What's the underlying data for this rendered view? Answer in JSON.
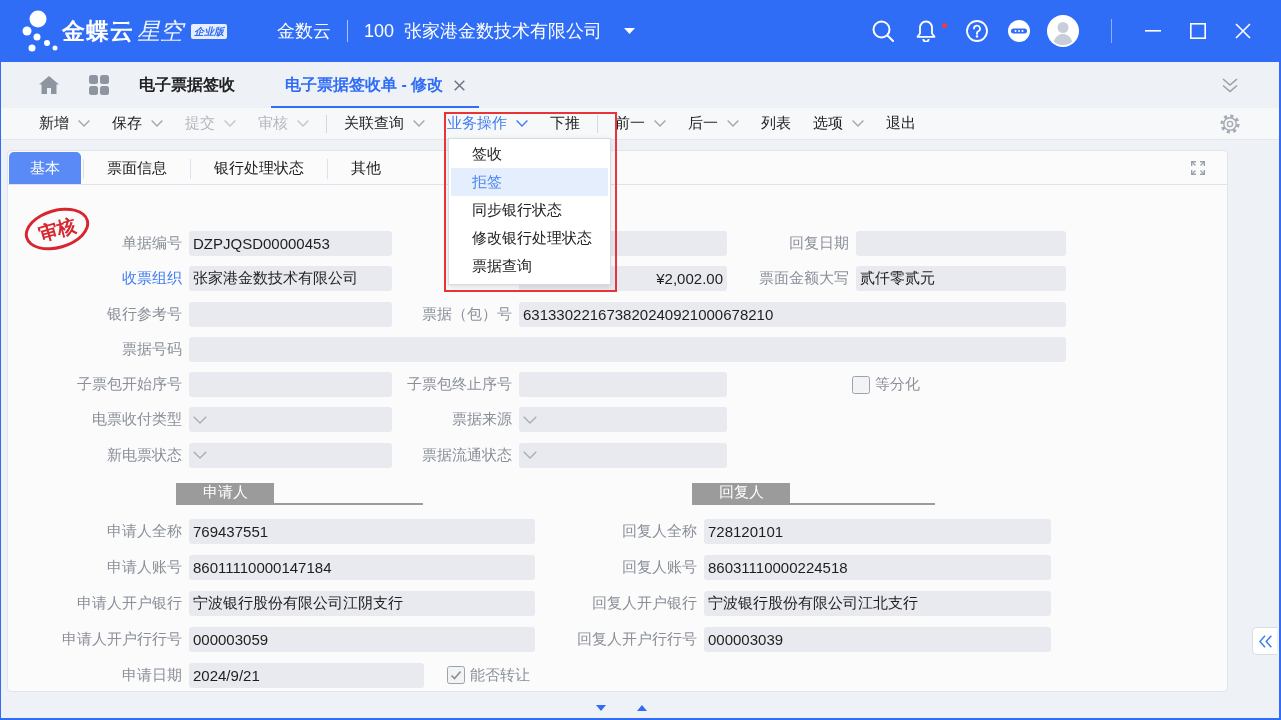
{
  "header": {
    "brand": "金蝶云",
    "product": "星空",
    "edition": "企业版",
    "tenant": "金数云",
    "org_code": "100",
    "org_name": "张家港金数技术有限公司",
    "unread": true
  },
  "page_tabs": [
    {
      "label": "电子票据签收",
      "selected": false,
      "closable": false
    },
    {
      "label": "电子票据签收单 - 修改",
      "selected": true,
      "closable": true
    }
  ],
  "toolbar": {
    "items": [
      {
        "label": "新增",
        "dropdown": true,
        "disabled": false,
        "selected": false,
        "divider_before": false
      },
      {
        "label": "保存",
        "dropdown": true,
        "disabled": false,
        "selected": false,
        "divider_before": false
      },
      {
        "label": "提交",
        "dropdown": true,
        "disabled": true,
        "selected": false,
        "divider_before": false
      },
      {
        "label": "审核",
        "dropdown": true,
        "disabled": true,
        "selected": false,
        "divider_before": false
      },
      {
        "label": "关联查询",
        "dropdown": true,
        "disabled": false,
        "selected": false,
        "divider_before": true
      },
      {
        "label": "业务操作",
        "dropdown": true,
        "disabled": false,
        "selected": true,
        "divider_before": false
      },
      {
        "label": "下推",
        "dropdown": false,
        "disabled": false,
        "selected": false,
        "divider_before": false
      },
      {
        "label": "前一",
        "dropdown": true,
        "disabled": false,
        "selected": false,
        "divider_before": true
      },
      {
        "label": "后一",
        "dropdown": true,
        "disabled": false,
        "selected": false,
        "divider_before": false
      },
      {
        "label": "列表",
        "dropdown": false,
        "disabled": false,
        "selected": false,
        "divider_before": false
      },
      {
        "label": "选项",
        "dropdown": true,
        "disabled": false,
        "selected": false,
        "divider_before": false
      },
      {
        "label": "退出",
        "dropdown": false,
        "disabled": false,
        "selected": false,
        "divider_before": false
      }
    ],
    "menu": [
      {
        "label": "签收",
        "selected": false
      },
      {
        "label": "拒签",
        "selected": true
      },
      {
        "label": "同步银行状态",
        "selected": false
      },
      {
        "label": "修改银行处理状态",
        "selected": false
      },
      {
        "label": "票据查询",
        "selected": false
      }
    ]
  },
  "form_tabs": [
    {
      "label": "基本",
      "selected": true
    },
    {
      "label": "票面信息",
      "selected": false
    },
    {
      "label": "银行处理状态",
      "selected": false
    },
    {
      "label": "其他",
      "selected": false
    }
  ],
  "stamp": "审核",
  "fields": [
    [
      {
        "kind": "text",
        "label": "单据编号",
        "value": "DZPJQSD00000453",
        "link": false,
        "wide": false
      },
      {
        "kind": "select"
      },
      {
        "kind": "text",
        "label": "回复日期",
        "link": false,
        "wide": false
      }
    ],
    [
      {
        "kind": "text",
        "label": "收票组织",
        "value": "张家港金数技术有限公司",
        "link": true,
        "wide": false
      },
      {
        "kind": "amount",
        "value": "¥2,002.00"
      },
      {
        "kind": "text",
        "label": "票面金额大写",
        "value": "贰仟零贰元",
        "link": false,
        "wide": false
      }
    ],
    [
      {
        "kind": "text",
        "label": "银行参考号",
        "link": false,
        "wide": false
      },
      {
        "kind": "text",
        "label": "票据（包）号",
        "value": "631330221673820240921000678210",
        "link": false,
        "wide": true
      }
    ],
    [
      {
        "kind": "text",
        "label": "票据号码",
        "link": false,
        "wide": true
      }
    ],
    [
      {
        "kind": "text",
        "label": "子票包开始序号",
        "link": false,
        "wide": false
      },
      {
        "kind": "text",
        "label": "子票包终止序号",
        "link": false,
        "wide": false
      },
      {
        "kind": "checkbox",
        "label": "等分化",
        "checked": false
      }
    ],
    [
      {
        "kind": "select",
        "label": "电票收付类型",
        "link": false,
        "wide": false
      },
      {
        "kind": "select",
        "label": "票据来源",
        "link": false,
        "wide": false
      }
    ],
    [
      {
        "kind": "select",
        "label": "新电票状态",
        "link": false,
        "wide": false
      },
      {
        "kind": "select",
        "label": "票据流通状态",
        "link": false,
        "wide": false
      }
    ]
  ],
  "parties": [
    {
      "title": "申请人",
      "fields": [
        {
          "label": "申请人全称",
          "value": "769437551"
        },
        {
          "label": "申请人账号",
          "value": "86011110000147184"
        },
        {
          "label": "申请人开户银行",
          "value": "宁波银行股份有限公司江阴支行"
        },
        {
          "label": "申请人开户行行号",
          "value": "000003059"
        }
      ]
    },
    {
      "title": "回复人",
      "fields": [
        {
          "label": "回复人全称",
          "value": "728120101"
        },
        {
          "label": "回复人账号",
          "value": "86031110000224518"
        },
        {
          "label": "回复人开户银行",
          "value": "宁波银行股份有限公司江北支行"
        },
        {
          "label": "回复人开户行行号",
          "value": "000003039"
        }
      ]
    }
  ],
  "bottom_row": [
    {
      "kind": "date",
      "label": "申请日期",
      "value": "2024/9/21"
    },
    {
      "kind": "checkbox",
      "label": "能否转让",
      "checked": true
    }
  ]
}
